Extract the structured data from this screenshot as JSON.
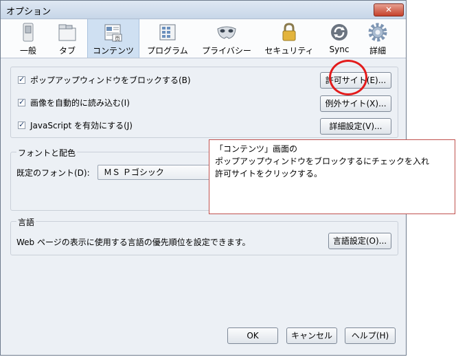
{
  "window": {
    "title": "オプション",
    "close_glyph": "✕"
  },
  "toolbar": {
    "items": [
      {
        "id": "general",
        "label": "一般",
        "icon": "switch-icon"
      },
      {
        "id": "tabs",
        "label": "タブ",
        "icon": "tabs-icon"
      },
      {
        "id": "content",
        "label": "コンテンツ",
        "icon": "content-page-icon",
        "selected": true
      },
      {
        "id": "applications",
        "label": "プログラム",
        "icon": "applications-icon"
      },
      {
        "id": "privacy",
        "label": "プライバシー",
        "icon": "mask-icon"
      },
      {
        "id": "security",
        "label": "セキュリティ",
        "icon": "padlock-icon"
      },
      {
        "id": "sync",
        "label": "Sync",
        "icon": "sync-icon"
      },
      {
        "id": "advanced",
        "label": "詳細",
        "icon": "gear-icon"
      }
    ]
  },
  "content": {
    "popups": {
      "label": "ポップアップウィンドウをブロックする(B)",
      "checked": true,
      "button": "許可サイト(E)..."
    },
    "images": {
      "label": "画像を自動的に読み込む(I)",
      "checked": true,
      "button": "例外サイト(X)..."
    },
    "javascript": {
      "label": "JavaScript を有効にする(J)",
      "checked": true,
      "button": "詳細設定(V)..."
    },
    "fonts": {
      "title": "フォントと配色",
      "default_font_label": "既定のフォント(D):",
      "default_font_value": "ＭＳ Ｐゴシック"
    },
    "languages": {
      "title": "言語",
      "description": "Web ページの表示に使用する言語の優先順位を設定できます。",
      "button": "言語設定(O)..."
    }
  },
  "footer": {
    "ok": "OK",
    "cancel": "キャンセル",
    "help": "ヘルプ(H)"
  },
  "annotation": {
    "line1": "「コンテンツ」画面の",
    "line2": "ポップアップウィンドウをブロックするにチェックを入れ",
    "line3": "許可サイトをクリックする。",
    "box_color": "#c0504d",
    "circle_color": "#e31b1b"
  }
}
